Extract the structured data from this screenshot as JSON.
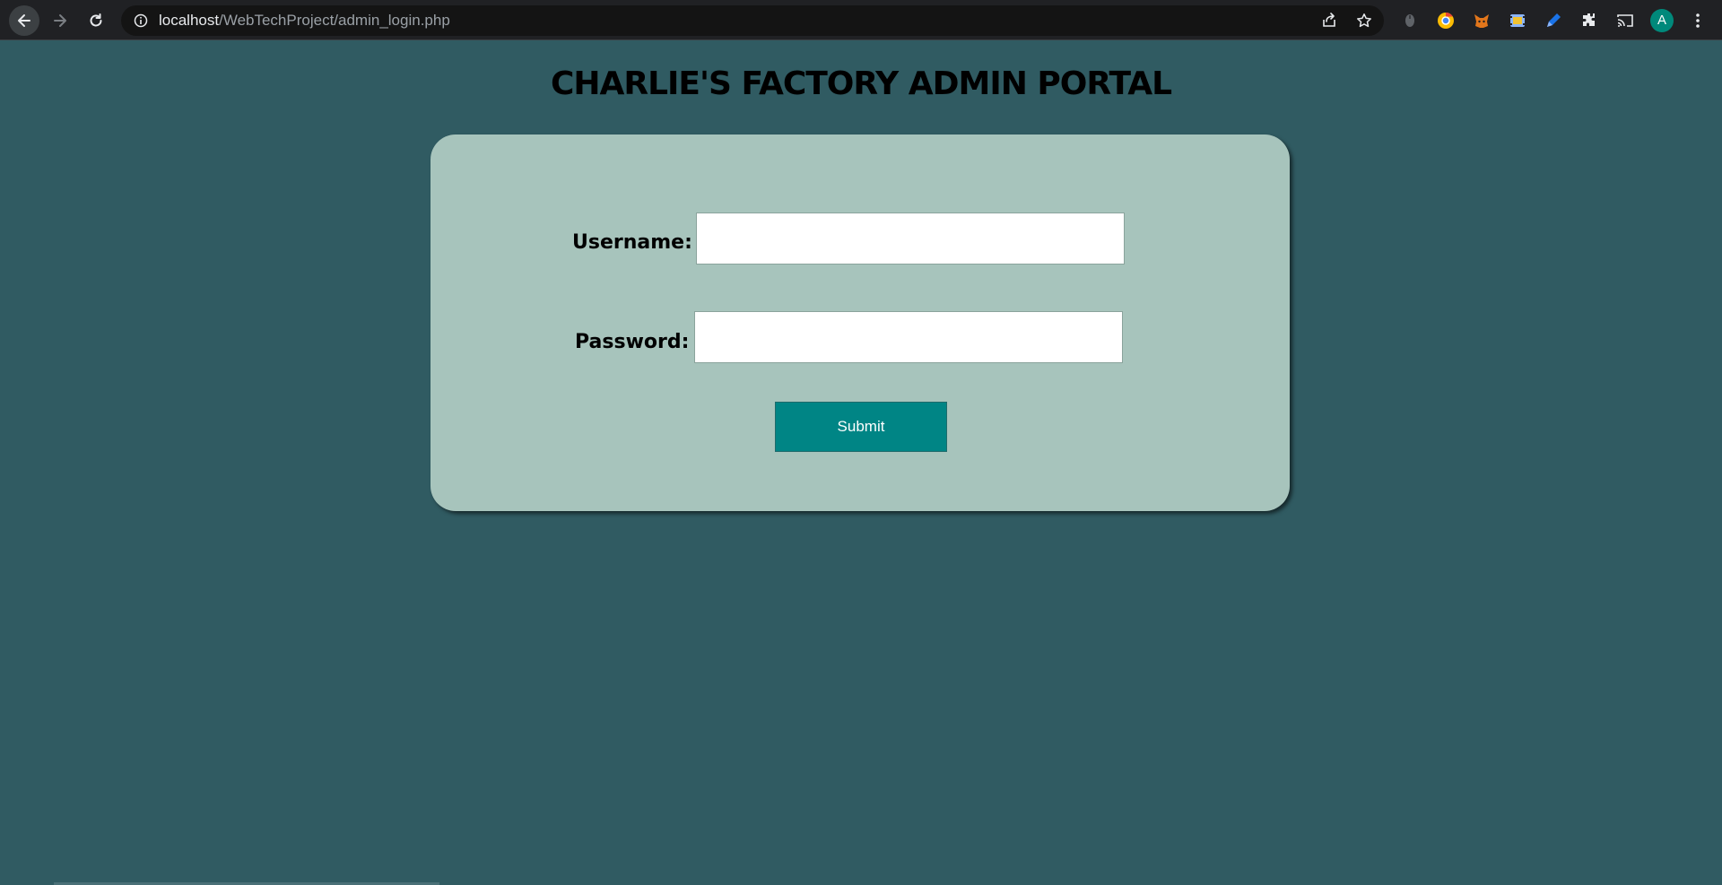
{
  "browser": {
    "url_host": "localhost",
    "url_path": "/WebTechProject/admin_login.php",
    "avatar_letter": "A",
    "icons": [
      "back-arrow-icon",
      "forward-arrow-icon",
      "reload-icon",
      "info-icon",
      "share-icon",
      "bookmark-star-icon",
      "extension-icons",
      "puzzle-extensions-icon",
      "cast-icon",
      "kebab-menu-icon"
    ]
  },
  "page": {
    "title": "CHARLIE'S FACTORY ADMIN PORTAL",
    "background_color": "#305b62",
    "card_color": "#a7c4bc",
    "accent_color": "#008585"
  },
  "form": {
    "username_label": "Username:",
    "username_value": "",
    "password_label": "Password:",
    "password_value": "",
    "submit_label": "Submit"
  }
}
